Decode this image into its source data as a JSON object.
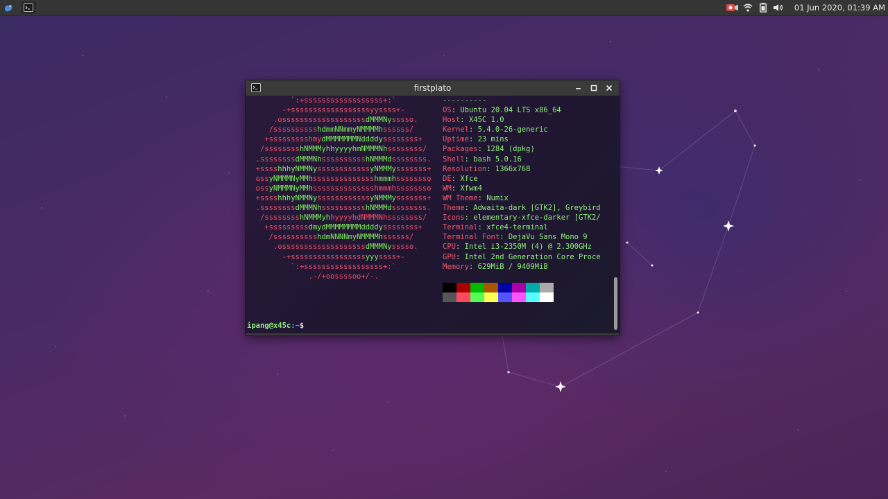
{
  "panel": {
    "clock": "01 Jun 2020, 01:39 AM",
    "launcher_icon": "xfce-mouse-icon",
    "task_icon": "terminal-icon",
    "tray_icons": [
      "record-icon",
      "wifi-icon",
      "battery-icon",
      "volume-icon"
    ]
  },
  "terminal": {
    "title": "firstplato",
    "ascii_art": [
      [
        [
          "r",
          "          `:+ssssssssssssssssss+:`"
        ]
      ],
      [
        [
          "r",
          "        -+ssssssssssssssssssyyssss+-"
        ]
      ],
      [
        [
          "r",
          "      .osssssssssssssssssss"
        ],
        [
          "g",
          "dMMMNy"
        ],
        [
          "r",
          "sssso."
        ]
      ],
      [
        [
          "r",
          "     /ssssssssss"
        ],
        [
          "g",
          "hdmmNNmmyNMMMMh"
        ],
        [
          "r",
          "ssssss/"
        ]
      ],
      [
        [
          "r",
          "    +ssssssssshmy"
        ],
        [
          "g",
          "dMMMMMMMNddddy"
        ],
        [
          "r",
          "ssssssss+"
        ]
      ],
      [
        [
          "r",
          "   /ssssssss"
        ],
        [
          "g",
          "hNMMMyhhyyyyhmNMMMNh"
        ],
        [
          "r",
          "ssssssss/"
        ]
      ],
      [
        [
          "r",
          "  .ssssssss"
        ],
        [
          "g",
          "dMMMNh"
        ],
        [
          "r",
          "ssssssssss"
        ],
        [
          "g",
          "hNMMMd"
        ],
        [
          "r",
          "ssssssss."
        ]
      ],
      [
        [
          "r",
          "  +ssss"
        ],
        [
          "g",
          "hhhyNMMNy"
        ],
        [
          "r",
          "ssssssssssss"
        ],
        [
          "g",
          "yNMMMy"
        ],
        [
          "r",
          "sssssss+"
        ]
      ],
      [
        [
          "r",
          "  oss"
        ],
        [
          "g",
          "yNMMMNyMMh"
        ],
        [
          "r",
          "ssssssssssssss"
        ],
        [
          "g",
          "hmmmh"
        ],
        [
          "r",
          "ssssssso"
        ]
      ],
      [
        [
          "r",
          "  oss"
        ],
        [
          "g",
          "yNMMMNyMMh"
        ],
        [
          "r",
          "sssssssssssssshmmmhssssssso"
        ]
      ],
      [
        [
          "r",
          "  +ssss"
        ],
        [
          "g",
          "hhhyNMMNy"
        ],
        [
          "r",
          "ssssssssssss"
        ],
        [
          "g",
          "yNMMMy"
        ],
        [
          "r",
          "sssssss+"
        ]
      ],
      [
        [
          "r",
          "  .ssssssss"
        ],
        [
          "g",
          "dMMMNh"
        ],
        [
          "r",
          "ssssssssss"
        ],
        [
          "g",
          "hNMMMd"
        ],
        [
          "r",
          "ssssssss."
        ]
      ],
      [
        [
          "r",
          "   /ssssssss"
        ],
        [
          "g",
          "hNMMMyh"
        ],
        [
          "r",
          "hyyyyhdNMMMNh"
        ],
        [
          "r",
          "ssssssss/"
        ]
      ],
      [
        [
          "r",
          "    +sssssssss"
        ],
        [
          "g",
          "dmydMMMMMMMMddddy"
        ],
        [
          "r",
          "ssssssss+"
        ]
      ],
      [
        [
          "r",
          "     /ssssssssss"
        ],
        [
          "g",
          "hdmNNNNmyNMMMMh"
        ],
        [
          "r",
          "ssssss/"
        ]
      ],
      [
        [
          "r",
          "      .osssssssssssssssssss"
        ],
        [
          "g",
          "dMMMNy"
        ],
        [
          "r",
          "sssso."
        ]
      ],
      [
        [
          "r",
          "        -+sssssssssssssssss"
        ],
        [
          "g",
          "yyy"
        ],
        [
          "r",
          "ssss+-"
        ]
      ],
      [
        [
          "r",
          "          `:+ssssssssssssssssss+:`"
        ]
      ],
      [
        [
          "r",
          "              .-/+oossssoo+/-."
        ]
      ]
    ],
    "separator": "----------",
    "info": [
      {
        "key": "OS",
        "value": "Ubuntu 20.04 LTS x86_64"
      },
      {
        "key": "Host",
        "value": "X45C 1.0"
      },
      {
        "key": "Kernel",
        "value": "5.4.0-26-generic"
      },
      {
        "key": "Uptime",
        "value": "23 mins"
      },
      {
        "key": "Packages",
        "value": "1284 (dpkg)"
      },
      {
        "key": "Shell",
        "value": "bash 5.0.16"
      },
      {
        "key": "Resolution",
        "value": "1366x768"
      },
      {
        "key": "DE",
        "value": "Xfce"
      },
      {
        "key": "WM",
        "value": "Xfwm4"
      },
      {
        "key": "WM Theme",
        "value": "Numix"
      },
      {
        "key": "Theme",
        "value": "Adwaita-dark [GTK2], Greybird"
      },
      {
        "key": "Icons",
        "value": "elementary-xfce-darker [GTK2/"
      },
      {
        "key": "Terminal",
        "value": "xfce4-terminal"
      },
      {
        "key": "Terminal Font",
        "value": "DejaVu Sans Mono 9"
      },
      {
        "key": "CPU",
        "value": "Intel i3-2350M (4) @ 2.300GHz"
      },
      {
        "key": "GPU",
        "value": "Intel 2nd Generation Core Proce"
      },
      {
        "key": "Memory",
        "value": "629MiB / 9409MiB"
      }
    ],
    "palette_top": [
      "#000000",
      "#aa0000",
      "#00bb00",
      "#aa5500",
      "#0000aa",
      "#aa00aa",
      "#00aaaa",
      "#aaaaaa"
    ],
    "palette_bottom": [
      "#555555",
      "#ff4a5e",
      "#55ff55",
      "#ffff55",
      "#5555ff",
      "#ff55ff",
      "#55ffff",
      "#ffffff"
    ],
    "prompt_user": "ipang@x45c",
    "prompt_path": ":~",
    "prompt_symbol": "$"
  }
}
